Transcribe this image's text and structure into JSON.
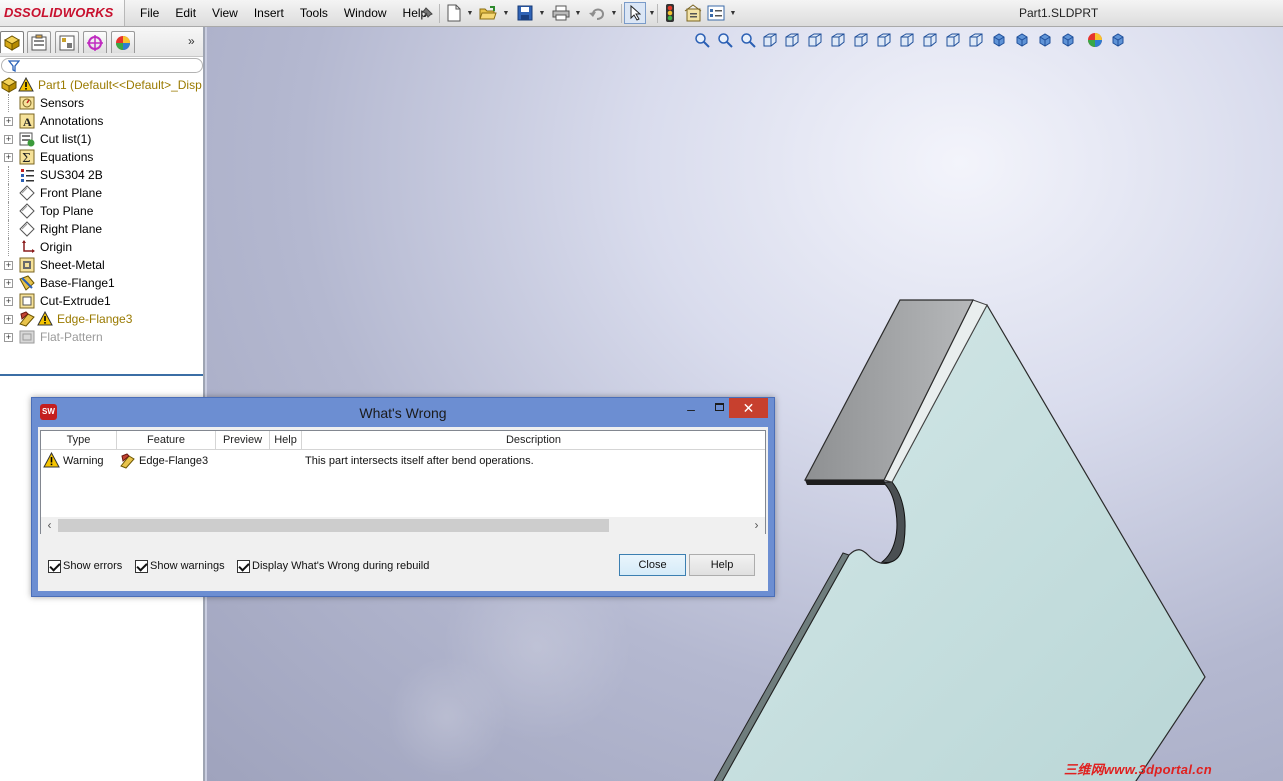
{
  "app": {
    "brand_prefix": "DS",
    "brand_name": "SOLIDWORKS",
    "document_title": "Part1.SLDPRT"
  },
  "menu": [
    "File",
    "Edit",
    "View",
    "Insert",
    "Tools",
    "Window",
    "Help"
  ],
  "feature_tree": {
    "root": "Part1  (Default<<Default>_Disp",
    "items": [
      {
        "label": "Sensors",
        "icon": "sensor-icon",
        "expandable": false
      },
      {
        "label": "Annotations",
        "icon": "annotations-icon",
        "expandable": true
      },
      {
        "label": "Cut list(1)",
        "icon": "cut-list-icon",
        "expandable": true
      },
      {
        "label": "Equations",
        "icon": "equations-icon",
        "expandable": true
      },
      {
        "label": "SUS304 2B",
        "icon": "material-icon",
        "expandable": false
      },
      {
        "label": "Front Plane",
        "icon": "plane-icon",
        "expandable": false
      },
      {
        "label": "Top Plane",
        "icon": "plane-icon",
        "expandable": false
      },
      {
        "label": "Right Plane",
        "icon": "plane-icon",
        "expandable": false
      },
      {
        "label": "Origin",
        "icon": "origin-icon",
        "expandable": false
      },
      {
        "label": "Sheet-Metal",
        "icon": "sheet-metal-icon",
        "expandable": true
      },
      {
        "label": "Base-Flange1",
        "icon": "base-flange-icon",
        "expandable": true
      },
      {
        "label": "Cut-Extrude1",
        "icon": "cut-extrude-icon",
        "expandable": true
      },
      {
        "label": "Edge-Flange3",
        "icon": "edge-flange-icon",
        "expandable": true,
        "warning": true
      },
      {
        "label": "Flat-Pattern",
        "icon": "flat-pattern-icon",
        "expandable": true,
        "suppressed": true
      }
    ]
  },
  "dialog": {
    "title": "What's Wrong",
    "columns": [
      "Type",
      "Feature",
      "Preview",
      "Help",
      "Description"
    ],
    "rows": [
      {
        "type": "Warning",
        "feature": "Edge-Flange3",
        "preview": "",
        "help": "",
        "description": "This part intersects itself after bend operations."
      }
    ],
    "checkboxes": [
      {
        "label": "Show errors",
        "checked": true
      },
      {
        "label": "Show warnings",
        "checked": true
      },
      {
        "label": "Display What's Wrong during rebuild",
        "checked": true
      }
    ],
    "close_label": "Close",
    "help_label": "Help",
    "close_glyph": "✕",
    "min_glyph": "–"
  },
  "watermark": "三维网www.3dportal.cn",
  "colors": {
    "brand_red": "#c8102e",
    "warning_yellow": "#f5c400",
    "dialog_frame": "#6c8ed2",
    "close_button": "#c7402e",
    "part_face": "#c4dede",
    "flange_face": "#a9aaab"
  }
}
